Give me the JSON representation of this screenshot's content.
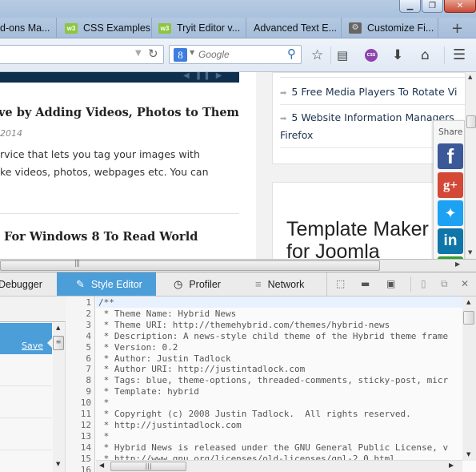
{
  "window": {
    "minimize_icon": "minimize-icon",
    "maximize_icon": "restore-icon",
    "close_icon": "close-icon"
  },
  "tabs": [
    {
      "label": "d-ons Ma...",
      "icon": "none"
    },
    {
      "label": "CSS Examples",
      "icon": "w3schools-icon"
    },
    {
      "label": "Tryit Editor v...",
      "icon": "w3schools-icon"
    },
    {
      "label": "Advanced Text E...",
      "icon": "none"
    },
    {
      "label": "Customize Fi...",
      "icon": "gear-icon"
    }
  ],
  "new_tab_label": "+",
  "w3_text": "w3",
  "navbar": {
    "url_value": "",
    "search_engine": "Google",
    "search_placeholder": "Google",
    "g_letter": "8",
    "icons": [
      "bookmark-star-icon",
      "reading-list-icon",
      "css-addon-icon",
      "downloads-icon",
      "home-icon",
      "menu-icon"
    ],
    "css_badge": "CSS"
  },
  "page": {
    "slider_controls": "◀ ❚❚ ▶",
    "post1": {
      "title": "ve by Adding Videos, Photos to Them",
      "date": "2014",
      "excerpt": [
        "rvice that lets you tag your images with",
        "ke videos, photos, webpages etc. You can"
      ]
    },
    "post2": {
      "title": "For Windows 8 To Read World"
    },
    "related": [
      {
        "line1": "5 Free Media Players To Rotate Vi",
        "line2": ""
      },
      {
        "line1": "5 Website Information Managers",
        "line2": "Firefox"
      }
    ],
    "ad_title": [
      "Template Maker",
      "for Joomla"
    ],
    "share": {
      "label": "Share",
      "buttons": [
        {
          "name": "facebook",
          "glyph": "f",
          "color": "#3b5998"
        },
        {
          "name": "google-plus",
          "glyph": "g+",
          "color": "#d34836"
        },
        {
          "name": "twitter",
          "glyph": "🐦",
          "color": "#1da1f2"
        },
        {
          "name": "linkedin",
          "glyph": "in",
          "color": "#0e76a8"
        },
        {
          "name": "more",
          "glyph": "",
          "color": "#2ea12e"
        }
      ]
    }
  },
  "devtools": {
    "tabs": [
      {
        "label": "Debugger",
        "selected": false
      },
      {
        "label": "Style Editor",
        "selected": true
      },
      {
        "label": "Profiler",
        "selected": false
      },
      {
        "label": "Network",
        "selected": false
      }
    ],
    "accent": "#4c9ed9",
    "save_label": "Save",
    "code_lines": [
      "/**",
      " * Theme Name: Hybrid News",
      " * Theme URI: http://themehybrid.com/themes/hybrid-news",
      " * Description: A news-style child theme of the Hybrid theme frame",
      " * Version: 0.2",
      " * Author: Justin Tadlock",
      " * Author URI: http://justintadlock.com",
      " * Tags: blue, theme-options, threaded-comments, sticky-post, micr",
      " * Template: hybrid",
      " *",
      " * Copyright (c) 2008 Justin Tadlock.  All rights reserved.",
      " * http://justintadlock.com",
      " *",
      " * Hybrid News is released under the GNU General Public License, v",
      " * http://www.gnu.org/licenses/old-licenses/gpl-2.0.html",
      ""
    ],
    "line_numbers": [
      "1",
      "2",
      "3",
      "4",
      "5",
      "6",
      "7",
      "8",
      "9",
      "10",
      "11",
      "12",
      "13",
      "14",
      "15",
      "16"
    ]
  }
}
